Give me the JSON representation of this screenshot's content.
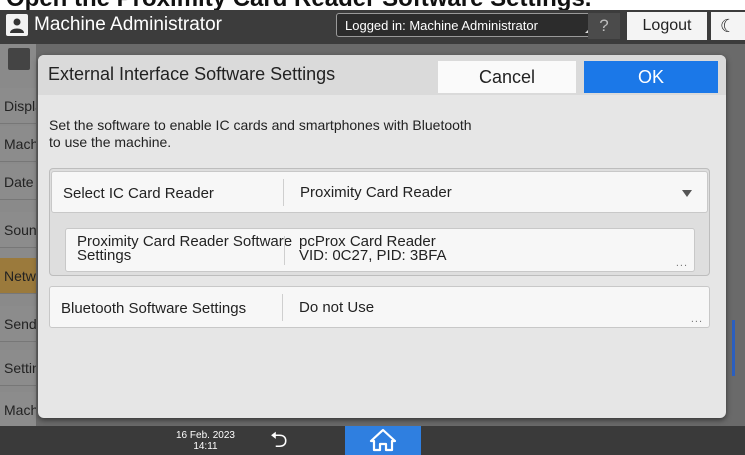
{
  "caption": {
    "text": "Open the Proximity Card Reader Software Settings."
  },
  "topbar": {
    "user_icon": "user-icon",
    "title": "Machine Administrator",
    "login_status": "Logged in: Machine Administrator",
    "help_label": "?",
    "logout_label": "Logout",
    "night_icon": "moon-icon",
    "night_label": "☾"
  },
  "background": {
    "settings_icon": "gear-icon",
    "sidebar_items": [
      "Display",
      "Machine",
      "Date",
      "Sound",
      "Network",
      "Send",
      "Settings",
      "Machine Information"
    ]
  },
  "modal": {
    "title": "External Interface Software Settings",
    "cancel_label": "Cancel",
    "ok_label": "OK",
    "description_line1": "Set the software to enable IC cards and smartphones with Bluetooth",
    "description_line2": "to use the machine.",
    "ic_reader": {
      "label": "Select IC Card Reader",
      "value": "Proximity Card Reader",
      "arrow_icon": "chevron-down-icon"
    },
    "proximity_settings": {
      "label_line1": "Proximity Card Reader Software",
      "label_line2": "Settings",
      "value_line1": "pcProx Card Reader",
      "value_line2": "VID: 0C27, PID: 3BFA",
      "more": "..."
    },
    "bluetooth": {
      "label": "Bluetooth Software Settings",
      "value": "Do not Use",
      "more": "..."
    }
  },
  "bottombar": {
    "date": "16 Feb. 2023",
    "time": "14:11",
    "back_icon": "back-arrow-icon",
    "back_glyph": "⮌",
    "home_icon": "home-icon"
  },
  "colors": {
    "accent": "#1b78e8",
    "active_sidebar": "#9b7a3c",
    "topbar": "#3c3c3c"
  }
}
